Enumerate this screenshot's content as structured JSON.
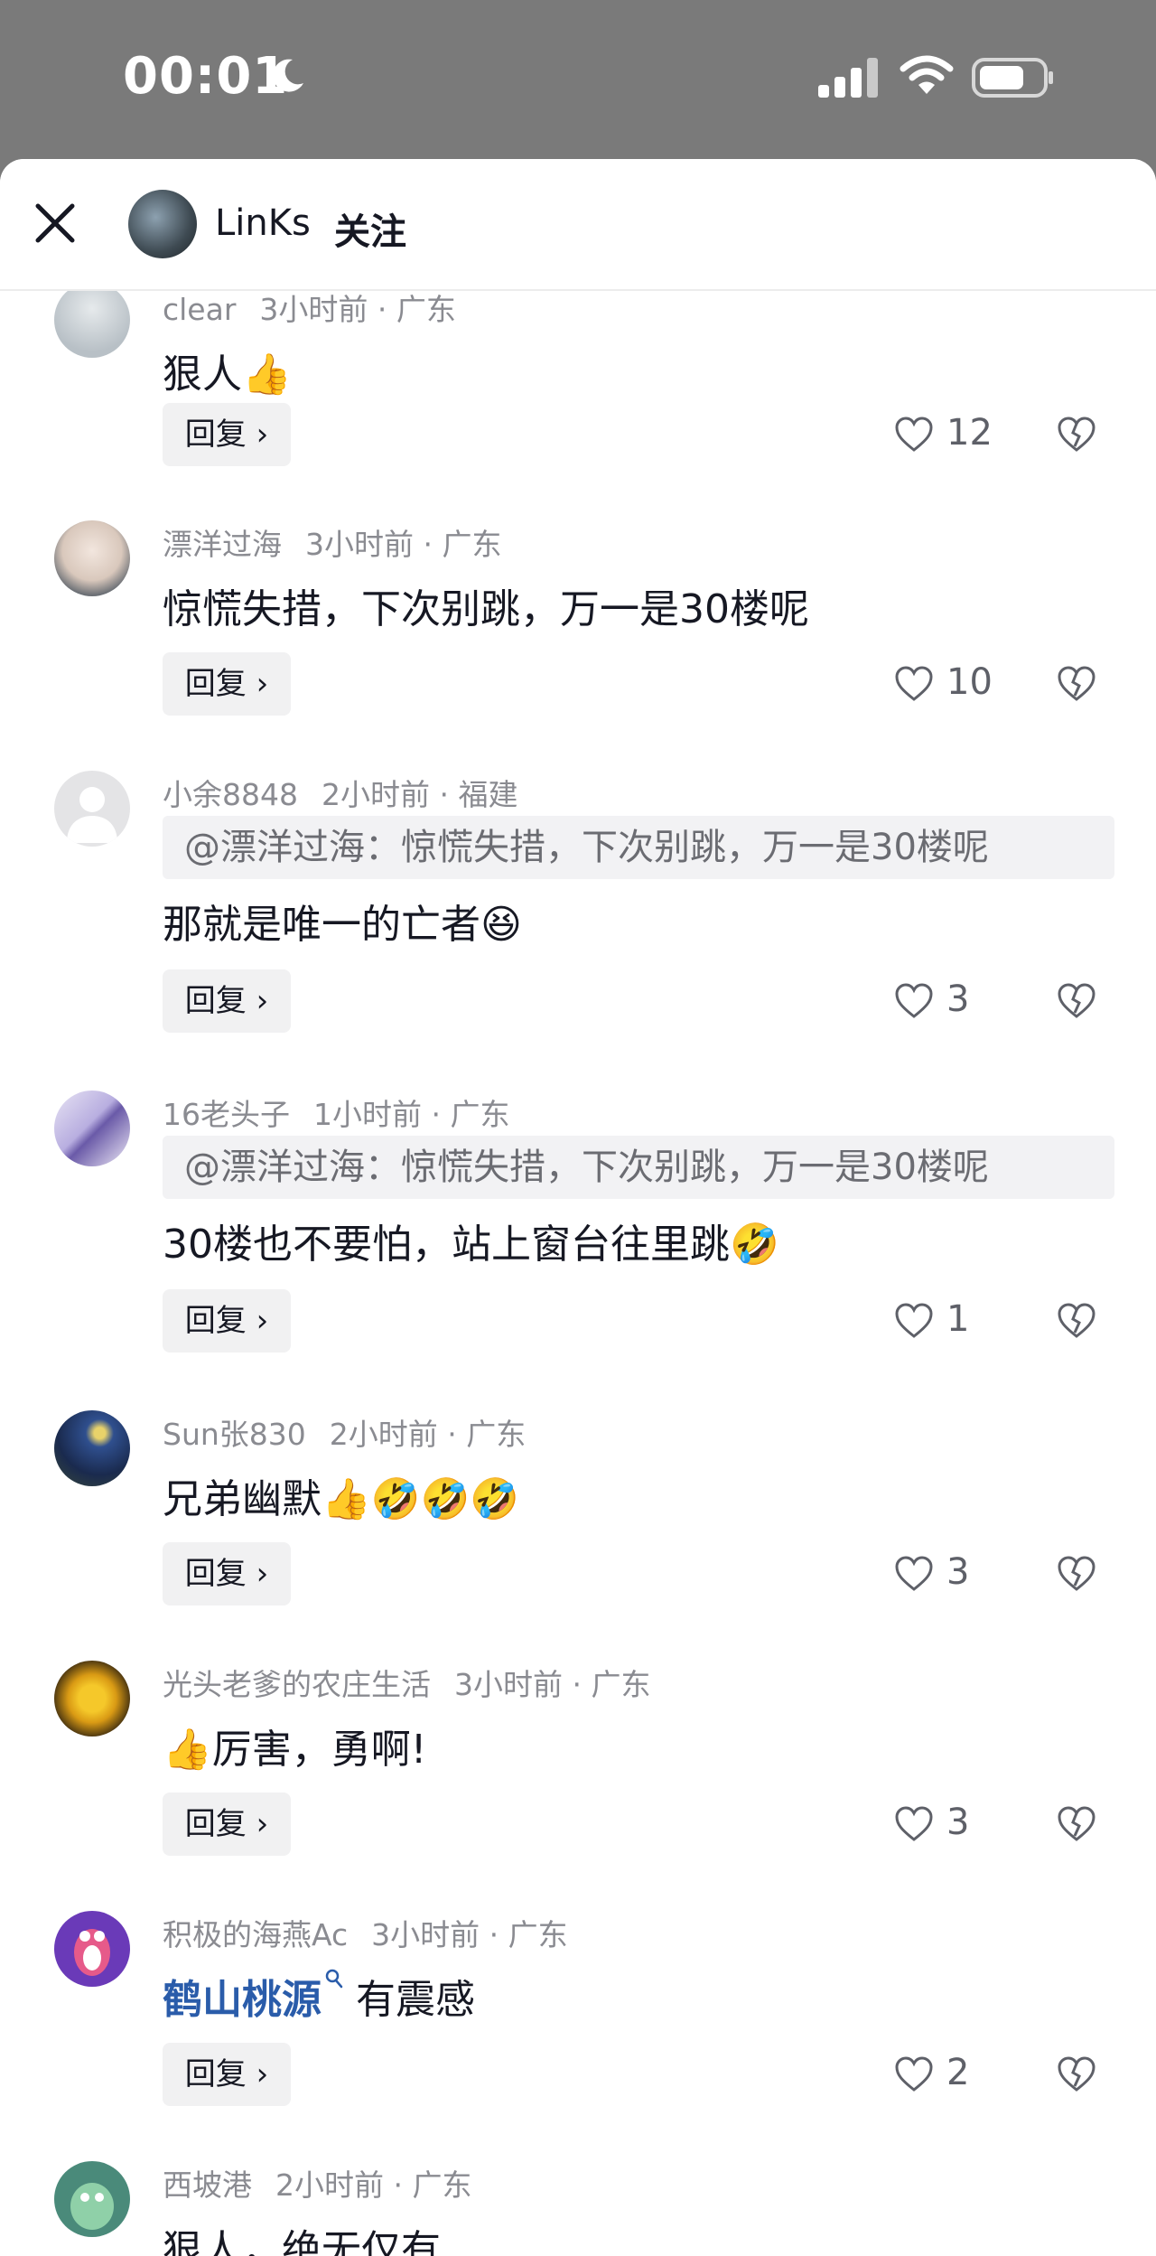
{
  "status_bar": {
    "time": "00:01"
  },
  "header": {
    "username": "LinKs",
    "follow_label": "关注"
  },
  "reply_label": "回复 ›",
  "comments": [
    {
      "username": "clear",
      "time": "3小时前",
      "location": "广东",
      "text": "狠人👍",
      "likes": "12"
    },
    {
      "username": "漂洋过海",
      "time": "3小时前",
      "location": "广东",
      "text": "惊慌失措，下次别跳，万一是30楼呢",
      "likes": "10"
    },
    {
      "username": "小余8848",
      "time": "2小时前",
      "location": "福建",
      "quote": "@漂洋过海：惊慌失措，下次别跳，万一是30楼呢",
      "text": "那就是唯一的亡者😆",
      "likes": "3"
    },
    {
      "username": "16老头子",
      "time": "1小时前",
      "location": "广东",
      "quote": "@漂洋过海：惊慌失措，下次别跳，万一是30楼呢",
      "text": "30楼也不要怕，站上窗台往里跳🤣",
      "likes": "1"
    },
    {
      "username": "Sun张830",
      "time": "2小时前",
      "location": "广东",
      "text": "兄弟幽默👍🤣🤣🤣",
      "likes": "3"
    },
    {
      "username": "光头老爹的农庄生活",
      "time": "3小时前",
      "location": "广东",
      "text": "👍厉害，勇啊!",
      "likes": "3"
    },
    {
      "username": "积极的海燕Ac",
      "time": "3小时前",
      "location": "广东",
      "mention": "鹤山桃源",
      "text": "有震感",
      "likes": "2"
    },
    {
      "username": "西坡港",
      "time": "2小时前",
      "location": "广东",
      "text": "狠人，绝无仅有"
    }
  ]
}
